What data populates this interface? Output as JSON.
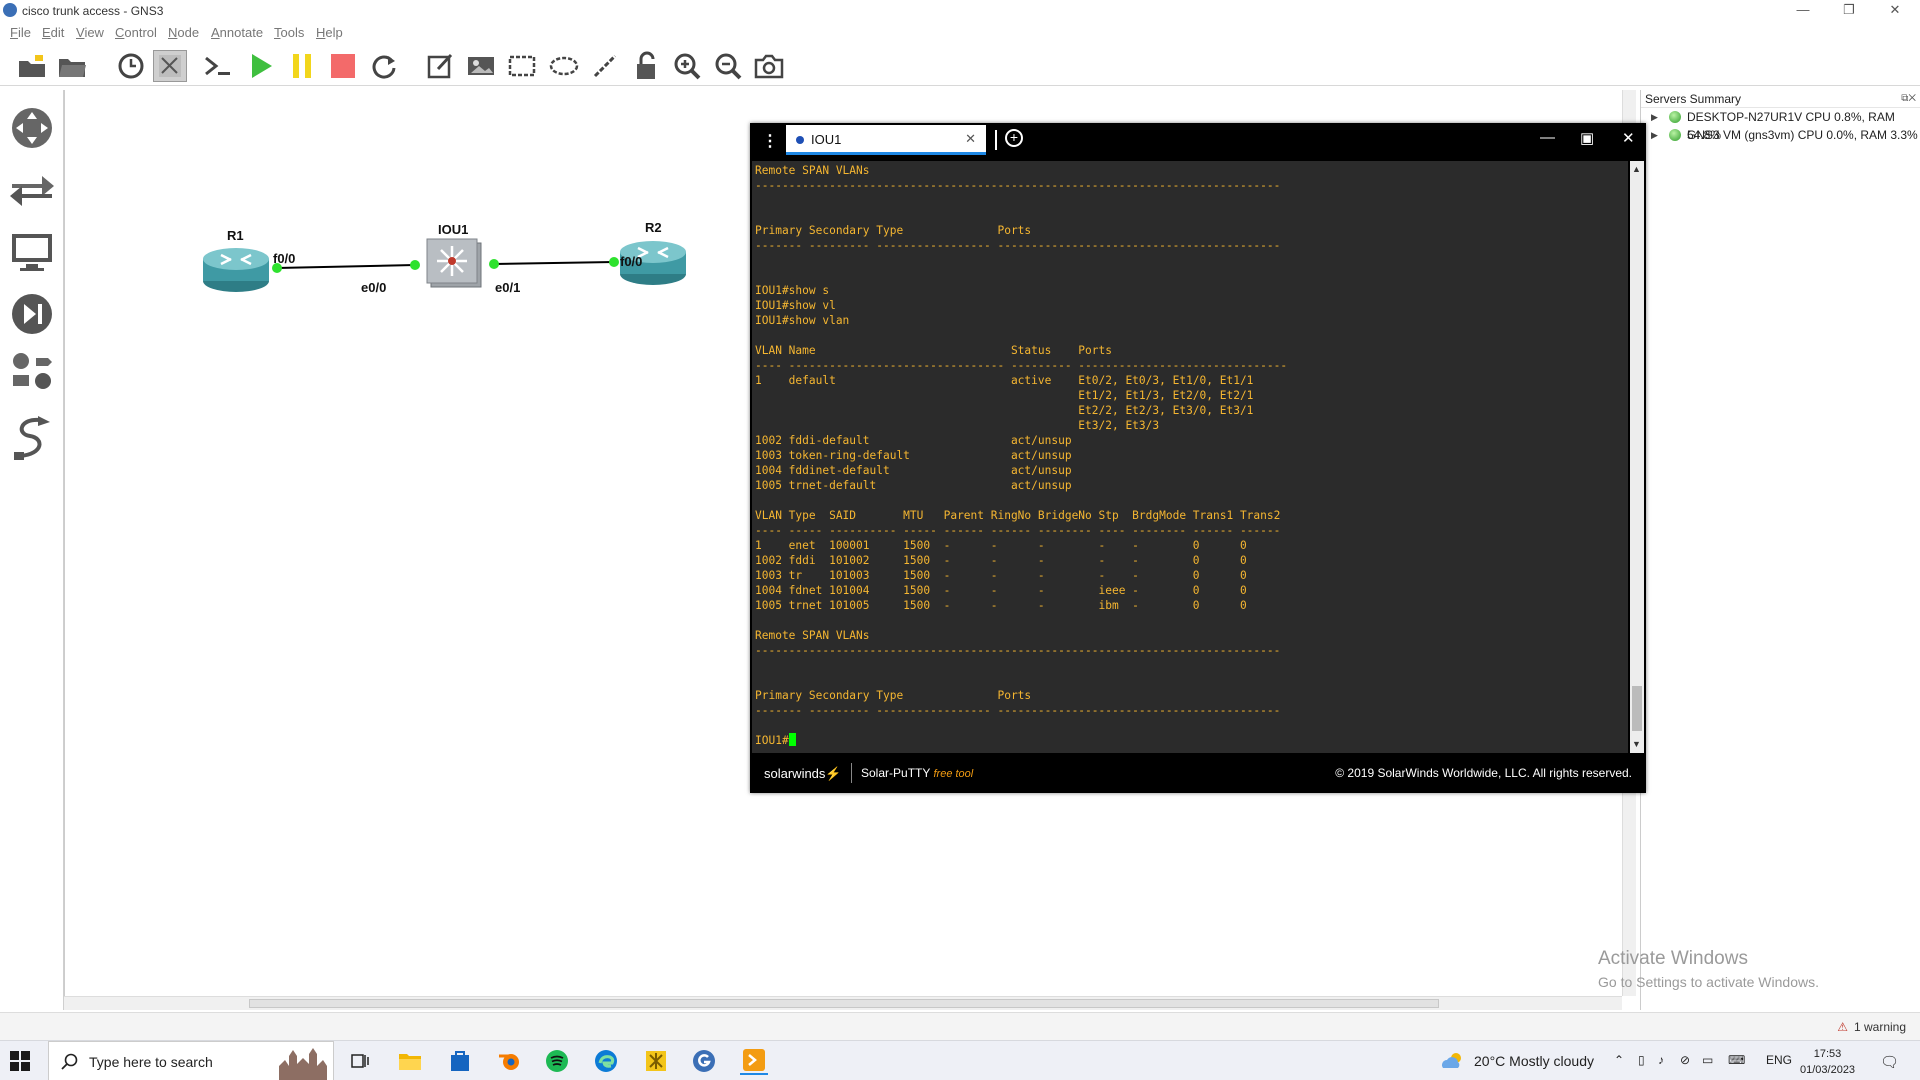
{
  "window": {
    "title": "cisco trunk access - GNS3",
    "min": "—",
    "max": "❐",
    "close": "✕"
  },
  "menu": [
    "File",
    "Edit",
    "View",
    "Control",
    "Node",
    "Annotate",
    "Tools",
    "Help"
  ],
  "topology": {
    "nodes": {
      "r1": "R1",
      "iou1": "IOU1",
      "r2": "R2"
    },
    "ports": {
      "r1_f00": "f0/0",
      "iou_e00": "e0/0",
      "iou_e01": "e0/1",
      "r2_f00": "f0/0"
    }
  },
  "servers": {
    "title": "Servers Summary",
    "items": [
      "DESKTOP-N27UR1V CPU 0.8%, RAM 54.8%",
      "GNS3 VM (gns3vm) CPU 0.0%, RAM 3.3%"
    ]
  },
  "activate": {
    "line1": "Activate Windows",
    "line2": "Go to Settings to activate Windows."
  },
  "status": {
    "warning": "1 warning"
  },
  "terminal": {
    "tab_name": "IOU1",
    "prompt": "IOU1#",
    "output": "Remote SPAN VLANs\n------------------------------------------------------------------------------\n\n\nPrimary Secondary Type              Ports\n------- --------- ----------------- ------------------------------------------\n\n\nIOU1#show s\nIOU1#show vl\nIOU1#show vlan\n\nVLAN Name                             Status    Ports\n---- -------------------------------- --------- -------------------------------\n1    default                          active    Et0/2, Et0/3, Et1/0, Et1/1\n                                                Et1/2, Et1/3, Et2/0, Et2/1\n                                                Et2/2, Et2/3, Et3/0, Et3/1\n                                                Et3/2, Et3/3\n1002 fddi-default                     act/unsup\n1003 token-ring-default               act/unsup\n1004 fddinet-default                  act/unsup\n1005 trnet-default                    act/unsup\n\nVLAN Type  SAID       MTU   Parent RingNo BridgeNo Stp  BrdgMode Trans1 Trans2\n---- ----- ---------- ----- ------ ------ -------- ---- -------- ------ ------\n1    enet  100001     1500  -      -      -        -    -        0      0\n1002 fddi  101002     1500  -      -      -        -    -        0      0\n1003 tr    101003     1500  -      -      -        -    -        0      0\n1004 fdnet 101004     1500  -      -      -        ieee -        0      0\n1005 trnet 101005     1500  -      -      -        ibm  -        0      0\n\nRemote SPAN VLANs\n------------------------------------------------------------------------------\n\n\nPrimary Secondary Type              Ports\n------- --------- ----------------- ------------------------------------------\n\n",
    "footer_brand": "solarwinds",
    "footer_product": "Solar-PuTTY",
    "footer_free": "free tool",
    "footer_copyright": "© 2019 SolarWinds Worldwide, LLC. All rights reserved."
  },
  "taskbar": {
    "search_placeholder": "Type here to search",
    "weather": "20°C  Mostly cloudy",
    "lang": "ENG",
    "time": "17:53",
    "date": "01/03/2023"
  }
}
